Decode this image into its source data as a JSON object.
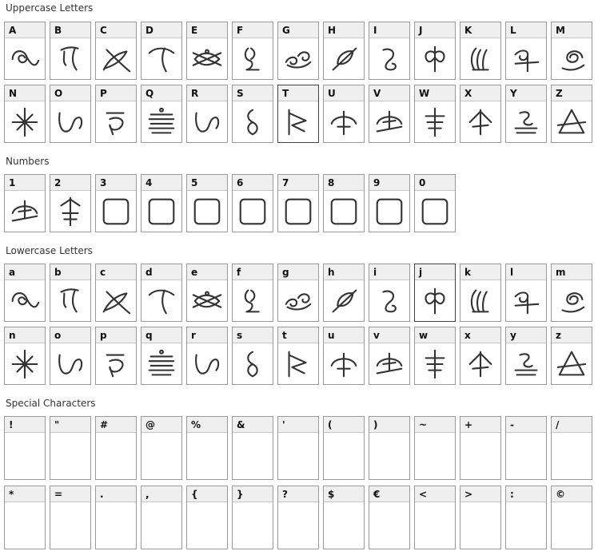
{
  "sections": [
    {
      "key": "upper",
      "title": "Uppercase Letters",
      "rows": [
        [
          {
            "c": "A",
            "g": "swirl"
          },
          {
            "c": "B",
            "g": "hook"
          },
          {
            "c": "C",
            "g": "cross-leaf"
          },
          {
            "c": "D",
            "g": "arch"
          },
          {
            "c": "E",
            "g": "fish"
          },
          {
            "c": "F",
            "g": "loop-l"
          },
          {
            "c": "G",
            "g": "double-swirl"
          },
          {
            "c": "H",
            "g": "leaf-slash"
          },
          {
            "c": "I",
            "g": "curl"
          },
          {
            "c": "J",
            "g": "moth"
          },
          {
            "c": "K",
            "g": "flame"
          },
          {
            "c": "L",
            "g": "wave-cross"
          },
          {
            "c": "M",
            "g": "spiral-stem"
          }
        ],
        [
          {
            "c": "N",
            "g": "star"
          },
          {
            "c": "O",
            "g": "wave-n"
          },
          {
            "c": "P",
            "g": "hook-3"
          },
          {
            "c": "Q",
            "g": "lines"
          },
          {
            "c": "R",
            "g": "wave-n"
          },
          {
            "c": "S",
            "g": "figure8"
          },
          {
            "c": "T",
            "g": "flag",
            "dark": true
          },
          {
            "c": "U",
            "g": "umbrella"
          },
          {
            "c": "V",
            "g": "umbrella-slash"
          },
          {
            "c": "W",
            "g": "fork"
          },
          {
            "c": "X",
            "g": "arrow-up"
          },
          {
            "c": "Y",
            "g": "ribbon"
          },
          {
            "c": "Z",
            "g": "triangle"
          }
        ]
      ]
    },
    {
      "key": "numbers",
      "title": "Numbers",
      "rows": [
        [
          {
            "c": "1",
            "g": "umbrella-slash"
          },
          {
            "c": "2",
            "g": "fork-arrow"
          },
          {
            "c": "3",
            "g": "box"
          },
          {
            "c": "4",
            "g": "box"
          },
          {
            "c": "5",
            "g": "box"
          },
          {
            "c": "6",
            "g": "box"
          },
          {
            "c": "7",
            "g": "box"
          },
          {
            "c": "8",
            "g": "box"
          },
          {
            "c": "9",
            "g": "box"
          },
          {
            "c": "0",
            "g": "box"
          }
        ]
      ]
    },
    {
      "key": "lower",
      "title": "Lowercase Letters",
      "rows": [
        [
          {
            "c": "a",
            "g": "swirl"
          },
          {
            "c": "b",
            "g": "hook"
          },
          {
            "c": "c",
            "g": "cross-leaf"
          },
          {
            "c": "d",
            "g": "arch"
          },
          {
            "c": "e",
            "g": "fish"
          },
          {
            "c": "f",
            "g": "loop-l"
          },
          {
            "c": "g",
            "g": "double-swirl"
          },
          {
            "c": "h",
            "g": "leaf-slash"
          },
          {
            "c": "i",
            "g": "curl"
          },
          {
            "c": "j",
            "g": "moth",
            "dark": true
          },
          {
            "c": "k",
            "g": "flame"
          },
          {
            "c": "l",
            "g": "wave-cross"
          },
          {
            "c": "m",
            "g": "spiral-stem"
          }
        ],
        [
          {
            "c": "n",
            "g": "star"
          },
          {
            "c": "o",
            "g": "wave-n"
          },
          {
            "c": "p",
            "g": "hook-3"
          },
          {
            "c": "q",
            "g": "lines"
          },
          {
            "c": "r",
            "g": "wave-n"
          },
          {
            "c": "s",
            "g": "figure8"
          },
          {
            "c": "t",
            "g": "flag"
          },
          {
            "c": "u",
            "g": "umbrella"
          },
          {
            "c": "v",
            "g": "umbrella-slash"
          },
          {
            "c": "w",
            "g": "fork"
          },
          {
            "c": "x",
            "g": "arrow-up"
          },
          {
            "c": "y",
            "g": "ribbon"
          },
          {
            "c": "z",
            "g": "triangle"
          }
        ]
      ]
    },
    {
      "key": "special",
      "title": "Special Characters",
      "rows": [
        [
          {
            "c": "!",
            "g": ""
          },
          {
            "c": "\"",
            "g": ""
          },
          {
            "c": "#",
            "g": ""
          },
          {
            "c": "@",
            "g": ""
          },
          {
            "c": "%",
            "g": ""
          },
          {
            "c": "&",
            "g": ""
          },
          {
            "c": "'",
            "g": ""
          },
          {
            "c": "(",
            "g": ""
          },
          {
            "c": ")",
            "g": ""
          },
          {
            "c": "~",
            "g": ""
          },
          {
            "c": "+",
            "g": ""
          },
          {
            "c": "-",
            "g": ""
          },
          {
            "c": "/",
            "g": ""
          }
        ],
        [
          {
            "c": "*",
            "g": ""
          },
          {
            "c": "=",
            "g": ""
          },
          {
            "c": ".",
            "g": ""
          },
          {
            "c": ",",
            "g": ""
          },
          {
            "c": "{",
            "g": ""
          },
          {
            "c": "}",
            "g": ""
          },
          {
            "c": "?",
            "g": ""
          },
          {
            "c": "$",
            "g": ""
          },
          {
            "c": "€",
            "g": ""
          },
          {
            "c": "<",
            "g": ""
          },
          {
            "c": ">",
            "g": ""
          },
          {
            "c": ":",
            "g": ""
          },
          {
            "c": "©",
            "g": ""
          }
        ]
      ]
    }
  ]
}
